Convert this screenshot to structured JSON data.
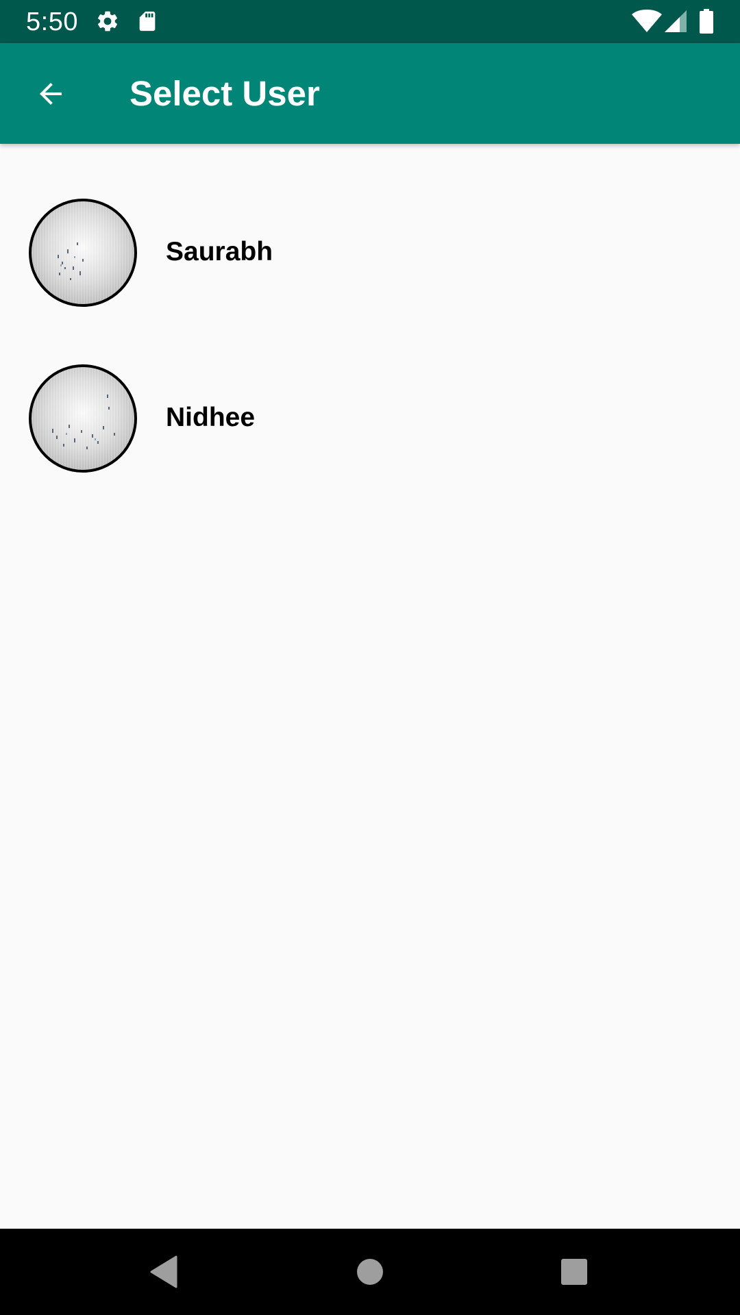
{
  "status_bar": {
    "time": "5:50",
    "icons": [
      "settings-icon",
      "sd-card-icon",
      "wifi-icon",
      "signal-icon",
      "battery-icon"
    ]
  },
  "app_bar": {
    "title": "Select User",
    "back_icon": "arrow-back-icon",
    "color": "#008577"
  },
  "users": [
    {
      "name": "Saurabh",
      "avatar": "avatar-photo"
    },
    {
      "name": "Nidhee",
      "avatar": "avatar-photo"
    }
  ],
  "nav_bar": {
    "buttons": [
      "nav-back-icon",
      "nav-home-icon",
      "nav-recents-icon"
    ]
  },
  "colors": {
    "status_bar": "#00574b",
    "app_bar": "#008577",
    "background": "#fafafa",
    "nav_bar": "#000000"
  }
}
